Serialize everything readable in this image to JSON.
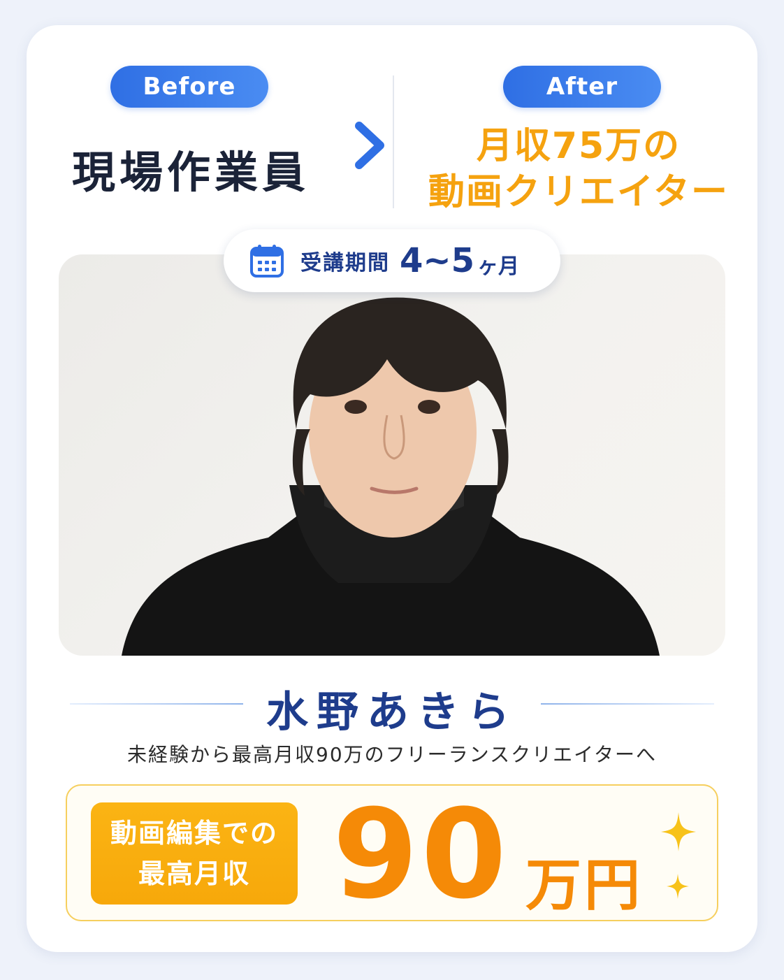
{
  "before": {
    "badge": "Before",
    "role": "現場作業員"
  },
  "after": {
    "badge": "After",
    "line1": "月収75万の",
    "line2": "動画クリエイター"
  },
  "period": {
    "label": "受講期間",
    "value": "4~5",
    "unit": "ヶ月"
  },
  "person": {
    "name": "水野あきら",
    "subtitle": "未経験から最高月収90万のフリーランスクリエイターへ"
  },
  "income": {
    "label_line1": "動画編集での",
    "label_line2": "最高月収",
    "value": "90",
    "unit": "万円"
  },
  "colors": {
    "blue_accent": "#2f6fe4",
    "navy_text": "#1e3c8c",
    "orange_accent": "#f5a20f",
    "income_orange": "#f58a07"
  },
  "icons": {
    "arrow": "arrow-right-icon",
    "calendar": "calendar-icon",
    "sparkle": "sparkle-icon"
  }
}
